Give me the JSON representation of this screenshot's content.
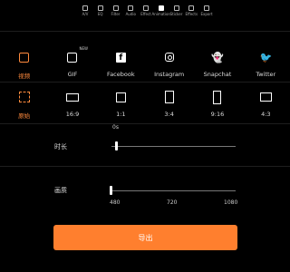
{
  "topbar": {
    "items": [
      {
        "label": "A/V"
      },
      {
        "label": "EQ"
      },
      {
        "label": "Filter"
      },
      {
        "label": "Audio"
      },
      {
        "label": "Effect"
      },
      {
        "label": "Animation"
      },
      {
        "label": "Sticker"
      },
      {
        "label": "Effects"
      },
      {
        "label": "Export"
      }
    ]
  },
  "share": {
    "items": [
      {
        "label": "视频",
        "icon": "edit-square-icon"
      },
      {
        "label": "GIF",
        "icon": "gif-edit-icon",
        "badge": "NEW"
      },
      {
        "label": "Facebook",
        "icon": "facebook-icon"
      },
      {
        "label": "Instagram",
        "icon": "instagram-icon"
      },
      {
        "label": "Snapchat",
        "icon": "snapchat-icon"
      },
      {
        "label": "Twitter",
        "icon": "twitter-icon"
      }
    ]
  },
  "ratio": {
    "items": [
      {
        "label": "原始",
        "icon": "fit-original-icon"
      },
      {
        "label": "16:9",
        "icon": "ratio-16-9-icon"
      },
      {
        "label": "1:1",
        "icon": "ratio-1-1-icon"
      },
      {
        "label": "3:4",
        "icon": "ratio-3-4-icon"
      },
      {
        "label": "9:16",
        "icon": "ratio-9-16-icon"
      },
      {
        "label": "4:3",
        "icon": "ratio-4-3-icon"
      }
    ]
  },
  "duration": {
    "label": "时长",
    "value_text": "0s"
  },
  "quality": {
    "label": "画质",
    "ticks": [
      "480",
      "720",
      "1080"
    ],
    "value": "480"
  },
  "export": {
    "label": "导出"
  },
  "colors": {
    "accent": "#ff7f2e",
    "background": "#000000"
  }
}
